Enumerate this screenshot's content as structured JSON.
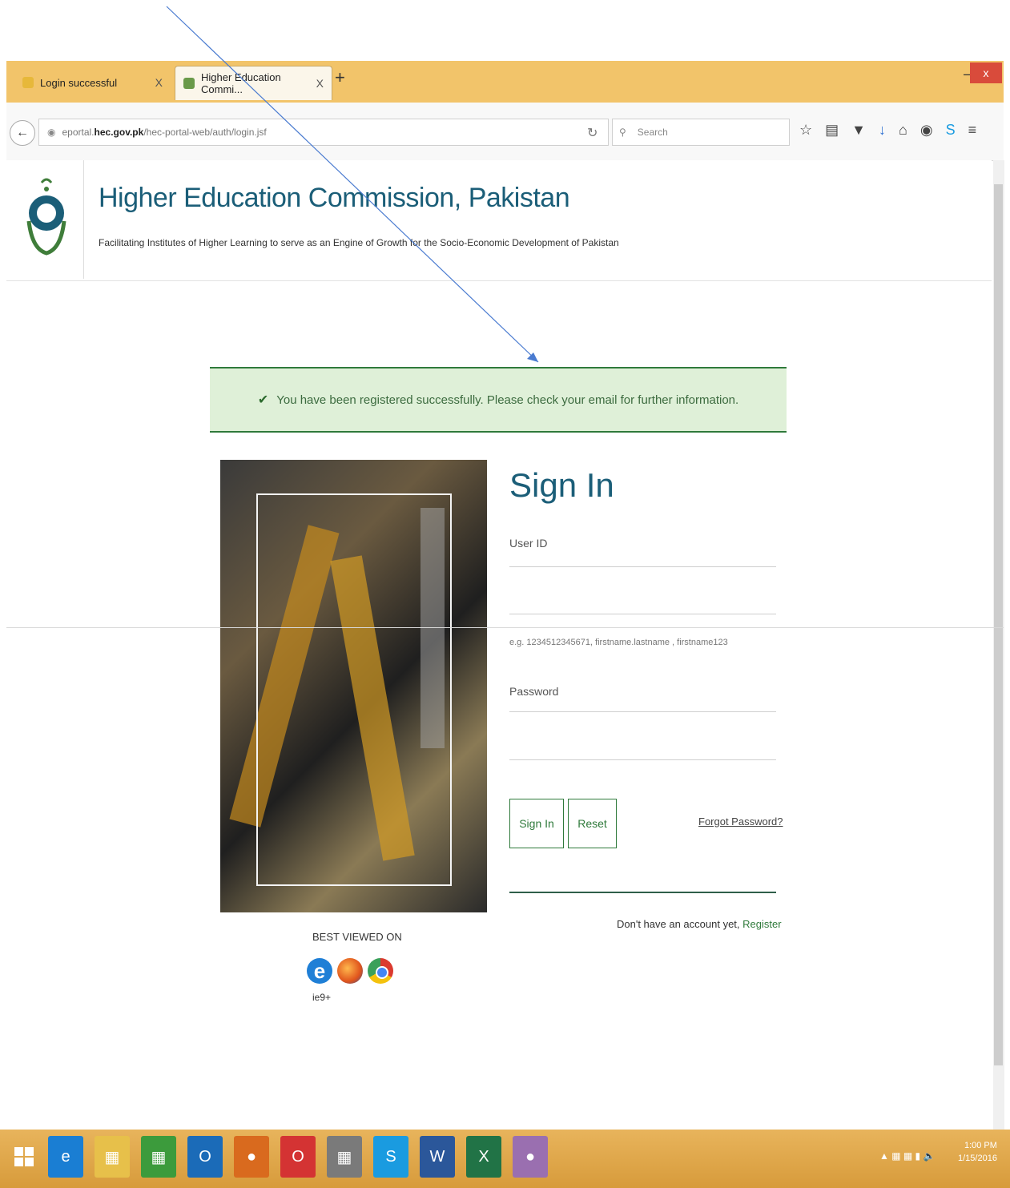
{
  "browser": {
    "tabs": [
      {
        "title": "Login successful",
        "close": "X"
      },
      {
        "title": "Higher Education Commi...",
        "close": "X"
      }
    ],
    "new_tab": "+",
    "window_controls": {
      "minimize": "–",
      "maximize": "□",
      "close": "x"
    },
    "url_prefix": "eportal.",
    "url_domain": "hec.gov.pk",
    "url_path": "/hec-portal-web/auth/login.jsf",
    "search_placeholder": "Search",
    "toolbar_icons": [
      "star-icon",
      "reading-list-icon",
      "pocket-icon",
      "download-icon",
      "home-icon",
      "sync-icon",
      "skype-icon",
      "menu-icon"
    ]
  },
  "header": {
    "title": "Higher Education Commission, Pakistan",
    "subtitle": "Facilitating Institutes of Higher Learning to serve as an Engine of Growth for the Socio-Economic Development of Pakistan"
  },
  "alert": {
    "message": "You have been registered successfully. Please check your email for further information.",
    "icon": "✔"
  },
  "best_viewed": {
    "label": "BEST VIEWED ON",
    "ie_label": "ie9+",
    "ie_glyph": "e"
  },
  "form": {
    "title": "Sign In",
    "user_label": "User ID",
    "user_value": "",
    "user_hint": "e.g. 1234512345671, firstname.lastname , firstname123",
    "password_label": "Password",
    "password_value": "",
    "sign_in_button": "Sign In",
    "reset_button": "Reset",
    "forgot_link": "Forgot Password?",
    "no_account_text": "Don't have an account yet, ",
    "register_link": "Register"
  },
  "taskbar": {
    "clock_time": "1:00 PM",
    "clock_date": "1/15/2016",
    "apps": [
      "ie-icon",
      "file-explorer-icon",
      "store-icon",
      "outlook-icon",
      "firefox-icon",
      "opera-icon",
      "calculator-icon",
      "skype-icon",
      "word-icon",
      "excel-icon",
      "paint-icon"
    ]
  },
  "colors": {
    "brand_blue": "#1b5e78",
    "success_green": "#2f7a3b",
    "alert_bg": "#dff0d8",
    "tab_bar": "#f2c46a"
  }
}
